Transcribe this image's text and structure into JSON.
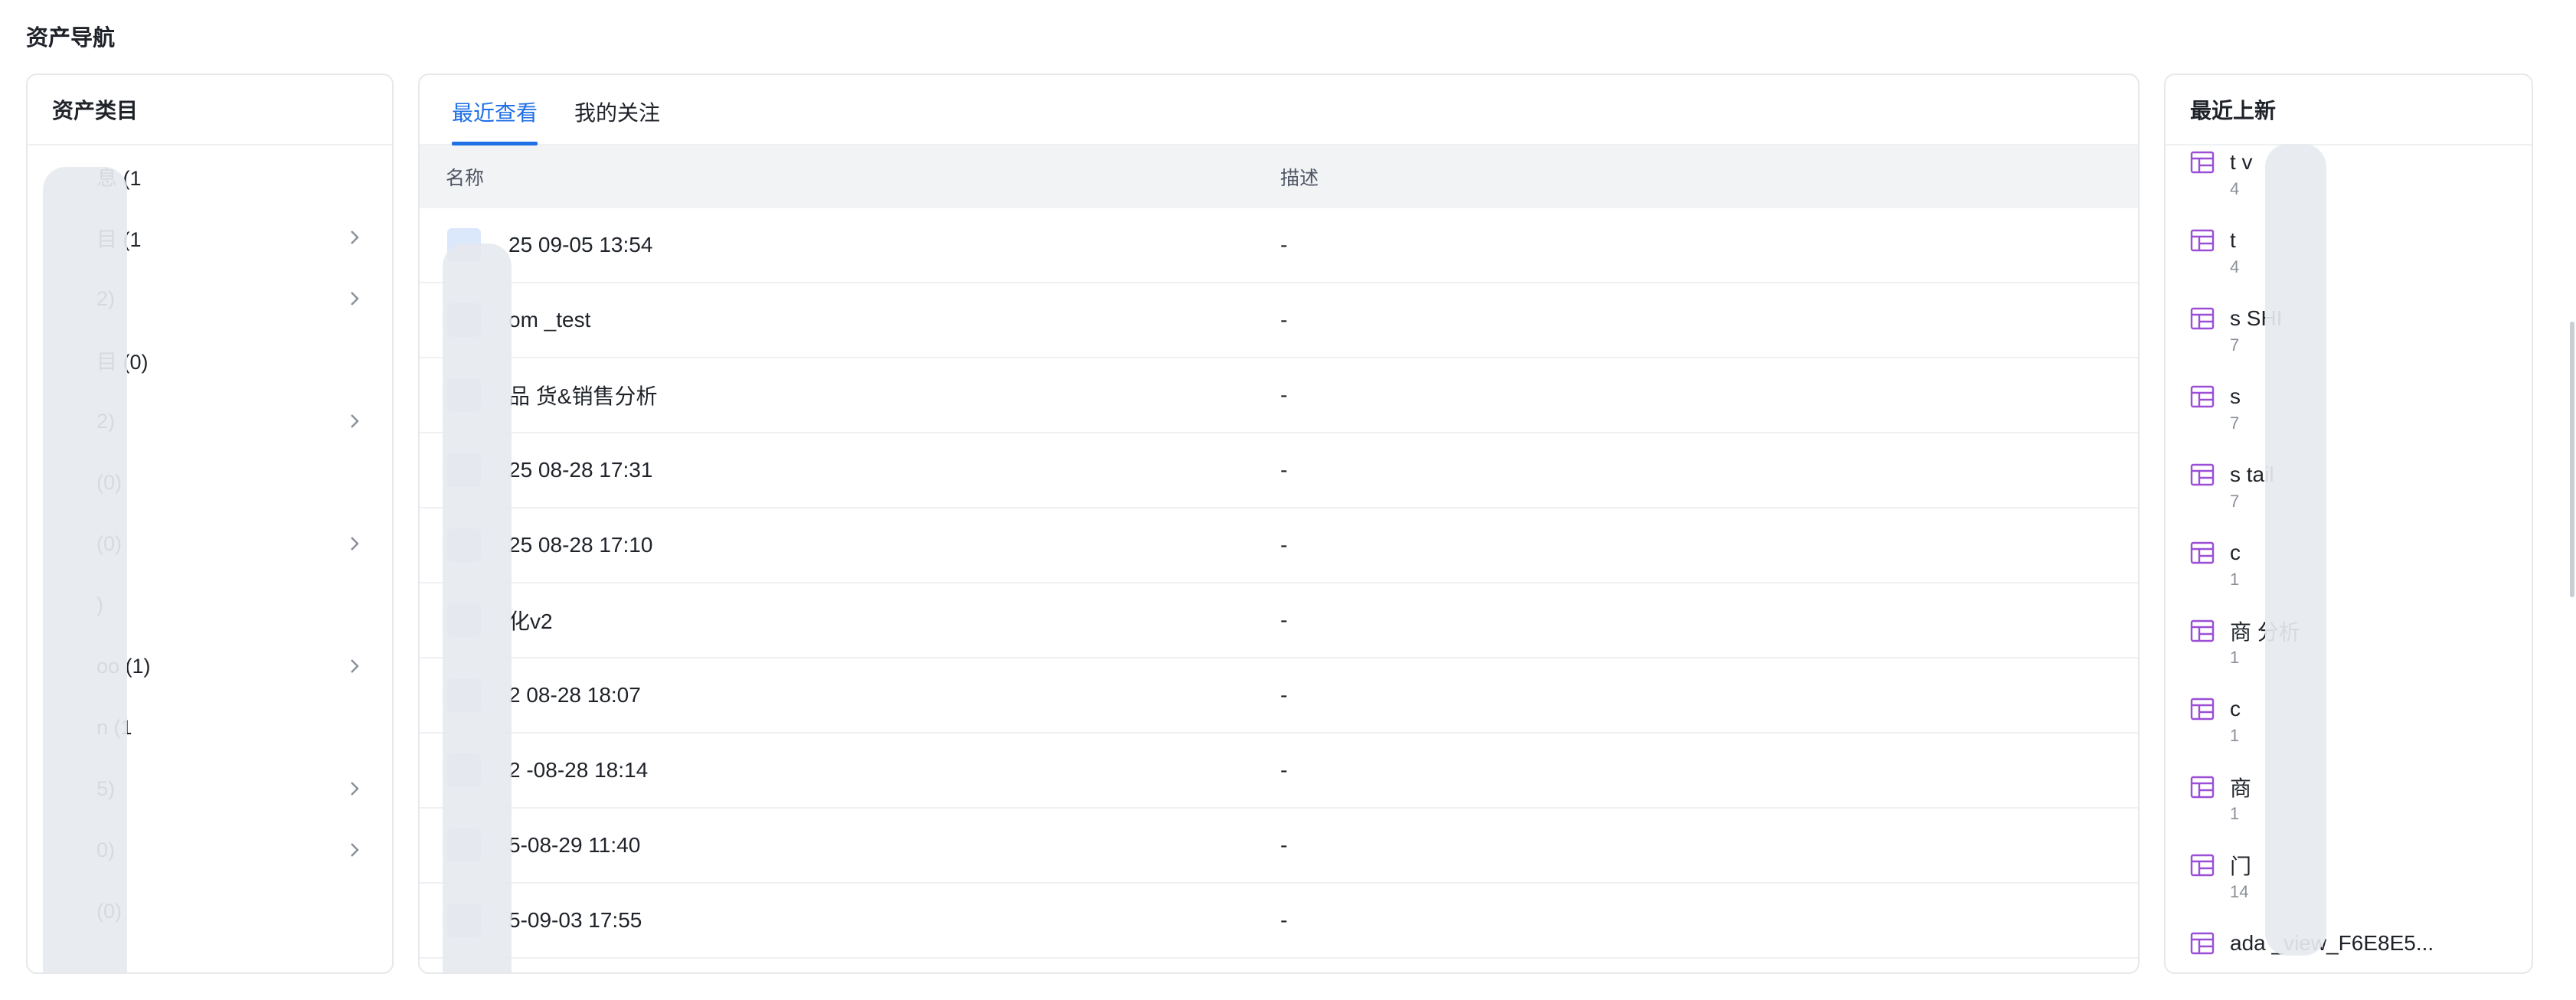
{
  "page": {
    "title": "资产导航"
  },
  "categories": {
    "title": "资产类目",
    "items": [
      {
        "label": "息 (1",
        "has_children": false
      },
      {
        "label": "目 (1",
        "has_children": true
      },
      {
        "label": "2)",
        "has_children": true
      },
      {
        "label": "目 (0)",
        "has_children": false
      },
      {
        "label": "2)",
        "has_children": true
      },
      {
        "label": "(0)",
        "has_children": false
      },
      {
        "label": "(0)",
        "has_children": true
      },
      {
        "label": ")",
        "has_children": false
      },
      {
        "label": "oo (1)",
        "has_children": true
      },
      {
        "label": "n (1",
        "has_children": false
      },
      {
        "label": "5)",
        "has_children": true
      },
      {
        "label": "0)",
        "has_children": true
      },
      {
        "label": "(0)",
        "has_children": false
      }
    ]
  },
  "main": {
    "tabs": [
      {
        "label": "最近查看",
        "active": true
      },
      {
        "label": "我的关注",
        "active": false
      }
    ],
    "columns": {
      "name": "名称",
      "desc": "描述"
    },
    "rows": [
      {
        "name": "25 09-05 13:54",
        "desc": "-"
      },
      {
        "name": "om _test",
        "desc": "-"
      },
      {
        "name": "品 货&销售分析",
        "desc": "-"
      },
      {
        "name": "25 08-28 17:31",
        "desc": "-"
      },
      {
        "name": "25 08-28 17:10",
        "desc": "-"
      },
      {
        "name": "化v2",
        "desc": "-"
      },
      {
        "name": "2 08-28 18:07",
        "desc": "-"
      },
      {
        "name": "2 -08-28 18:14",
        "desc": "-"
      },
      {
        "name": "5-08-29 11:40",
        "desc": "-"
      },
      {
        "name": "5-09-03 17:55",
        "desc": "-"
      }
    ]
  },
  "recent": {
    "title": "最近上新",
    "items": [
      {
        "name": "t v",
        "sub": "4",
        "icon": "view-icon"
      },
      {
        "name": "t",
        "sub": "4",
        "icon": "view-icon"
      },
      {
        "name": "s SHI",
        "sub": "7",
        "icon": "table-icon"
      },
      {
        "name": "s",
        "sub": "7",
        "icon": "table-icon"
      },
      {
        "name": "s tail",
        "sub": "7",
        "icon": "table-icon"
      },
      {
        "name": "c",
        "sub": "1",
        "icon": "table-icon"
      },
      {
        "name": "商 分析",
        "sub": "1",
        "icon": "table-icon"
      },
      {
        "name": "c",
        "sub": "1",
        "icon": "table-icon"
      },
      {
        "name": "商",
        "sub": "1",
        "icon": "table-icon"
      },
      {
        "name": "门",
        "sub": "14",
        "icon": "table-icon"
      },
      {
        "name": "ada _view_F6E8E5...",
        "sub": "",
        "icon": "table-icon"
      }
    ]
  },
  "colors": {
    "accent": "#1f6fe5",
    "table_icon": "#9b4fd6"
  }
}
